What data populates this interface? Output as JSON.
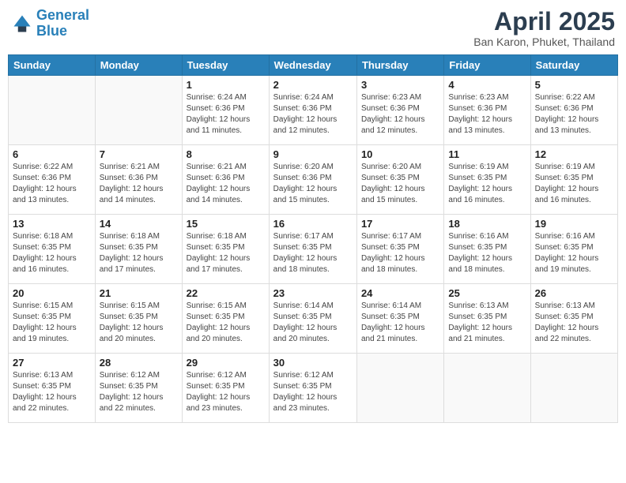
{
  "header": {
    "logo_line1": "General",
    "logo_line2": "Blue",
    "month_title": "April 2025",
    "location": "Ban Karon, Phuket, Thailand"
  },
  "weekdays": [
    "Sunday",
    "Monday",
    "Tuesday",
    "Wednesday",
    "Thursday",
    "Friday",
    "Saturday"
  ],
  "weeks": [
    [
      {
        "day": "",
        "info": ""
      },
      {
        "day": "",
        "info": ""
      },
      {
        "day": "1",
        "info": "Sunrise: 6:24 AM\nSunset: 6:36 PM\nDaylight: 12 hours\nand 11 minutes."
      },
      {
        "day": "2",
        "info": "Sunrise: 6:24 AM\nSunset: 6:36 PM\nDaylight: 12 hours\nand 12 minutes."
      },
      {
        "day": "3",
        "info": "Sunrise: 6:23 AM\nSunset: 6:36 PM\nDaylight: 12 hours\nand 12 minutes."
      },
      {
        "day": "4",
        "info": "Sunrise: 6:23 AM\nSunset: 6:36 PM\nDaylight: 12 hours\nand 13 minutes."
      },
      {
        "day": "5",
        "info": "Sunrise: 6:22 AM\nSunset: 6:36 PM\nDaylight: 12 hours\nand 13 minutes."
      }
    ],
    [
      {
        "day": "6",
        "info": "Sunrise: 6:22 AM\nSunset: 6:36 PM\nDaylight: 12 hours\nand 13 minutes."
      },
      {
        "day": "7",
        "info": "Sunrise: 6:21 AM\nSunset: 6:36 PM\nDaylight: 12 hours\nand 14 minutes."
      },
      {
        "day": "8",
        "info": "Sunrise: 6:21 AM\nSunset: 6:36 PM\nDaylight: 12 hours\nand 14 minutes."
      },
      {
        "day": "9",
        "info": "Sunrise: 6:20 AM\nSunset: 6:36 PM\nDaylight: 12 hours\nand 15 minutes."
      },
      {
        "day": "10",
        "info": "Sunrise: 6:20 AM\nSunset: 6:35 PM\nDaylight: 12 hours\nand 15 minutes."
      },
      {
        "day": "11",
        "info": "Sunrise: 6:19 AM\nSunset: 6:35 PM\nDaylight: 12 hours\nand 16 minutes."
      },
      {
        "day": "12",
        "info": "Sunrise: 6:19 AM\nSunset: 6:35 PM\nDaylight: 12 hours\nand 16 minutes."
      }
    ],
    [
      {
        "day": "13",
        "info": "Sunrise: 6:18 AM\nSunset: 6:35 PM\nDaylight: 12 hours\nand 16 minutes."
      },
      {
        "day": "14",
        "info": "Sunrise: 6:18 AM\nSunset: 6:35 PM\nDaylight: 12 hours\nand 17 minutes."
      },
      {
        "day": "15",
        "info": "Sunrise: 6:18 AM\nSunset: 6:35 PM\nDaylight: 12 hours\nand 17 minutes."
      },
      {
        "day": "16",
        "info": "Sunrise: 6:17 AM\nSunset: 6:35 PM\nDaylight: 12 hours\nand 18 minutes."
      },
      {
        "day": "17",
        "info": "Sunrise: 6:17 AM\nSunset: 6:35 PM\nDaylight: 12 hours\nand 18 minutes."
      },
      {
        "day": "18",
        "info": "Sunrise: 6:16 AM\nSunset: 6:35 PM\nDaylight: 12 hours\nand 18 minutes."
      },
      {
        "day": "19",
        "info": "Sunrise: 6:16 AM\nSunset: 6:35 PM\nDaylight: 12 hours\nand 19 minutes."
      }
    ],
    [
      {
        "day": "20",
        "info": "Sunrise: 6:15 AM\nSunset: 6:35 PM\nDaylight: 12 hours\nand 19 minutes."
      },
      {
        "day": "21",
        "info": "Sunrise: 6:15 AM\nSunset: 6:35 PM\nDaylight: 12 hours\nand 20 minutes."
      },
      {
        "day": "22",
        "info": "Sunrise: 6:15 AM\nSunset: 6:35 PM\nDaylight: 12 hours\nand 20 minutes."
      },
      {
        "day": "23",
        "info": "Sunrise: 6:14 AM\nSunset: 6:35 PM\nDaylight: 12 hours\nand 20 minutes."
      },
      {
        "day": "24",
        "info": "Sunrise: 6:14 AM\nSunset: 6:35 PM\nDaylight: 12 hours\nand 21 minutes."
      },
      {
        "day": "25",
        "info": "Sunrise: 6:13 AM\nSunset: 6:35 PM\nDaylight: 12 hours\nand 21 minutes."
      },
      {
        "day": "26",
        "info": "Sunrise: 6:13 AM\nSunset: 6:35 PM\nDaylight: 12 hours\nand 22 minutes."
      }
    ],
    [
      {
        "day": "27",
        "info": "Sunrise: 6:13 AM\nSunset: 6:35 PM\nDaylight: 12 hours\nand 22 minutes."
      },
      {
        "day": "28",
        "info": "Sunrise: 6:12 AM\nSunset: 6:35 PM\nDaylight: 12 hours\nand 22 minutes."
      },
      {
        "day": "29",
        "info": "Sunrise: 6:12 AM\nSunset: 6:35 PM\nDaylight: 12 hours\nand 23 minutes."
      },
      {
        "day": "30",
        "info": "Sunrise: 6:12 AM\nSunset: 6:35 PM\nDaylight: 12 hours\nand 23 minutes."
      },
      {
        "day": "",
        "info": ""
      },
      {
        "day": "",
        "info": ""
      },
      {
        "day": "",
        "info": ""
      }
    ]
  ]
}
